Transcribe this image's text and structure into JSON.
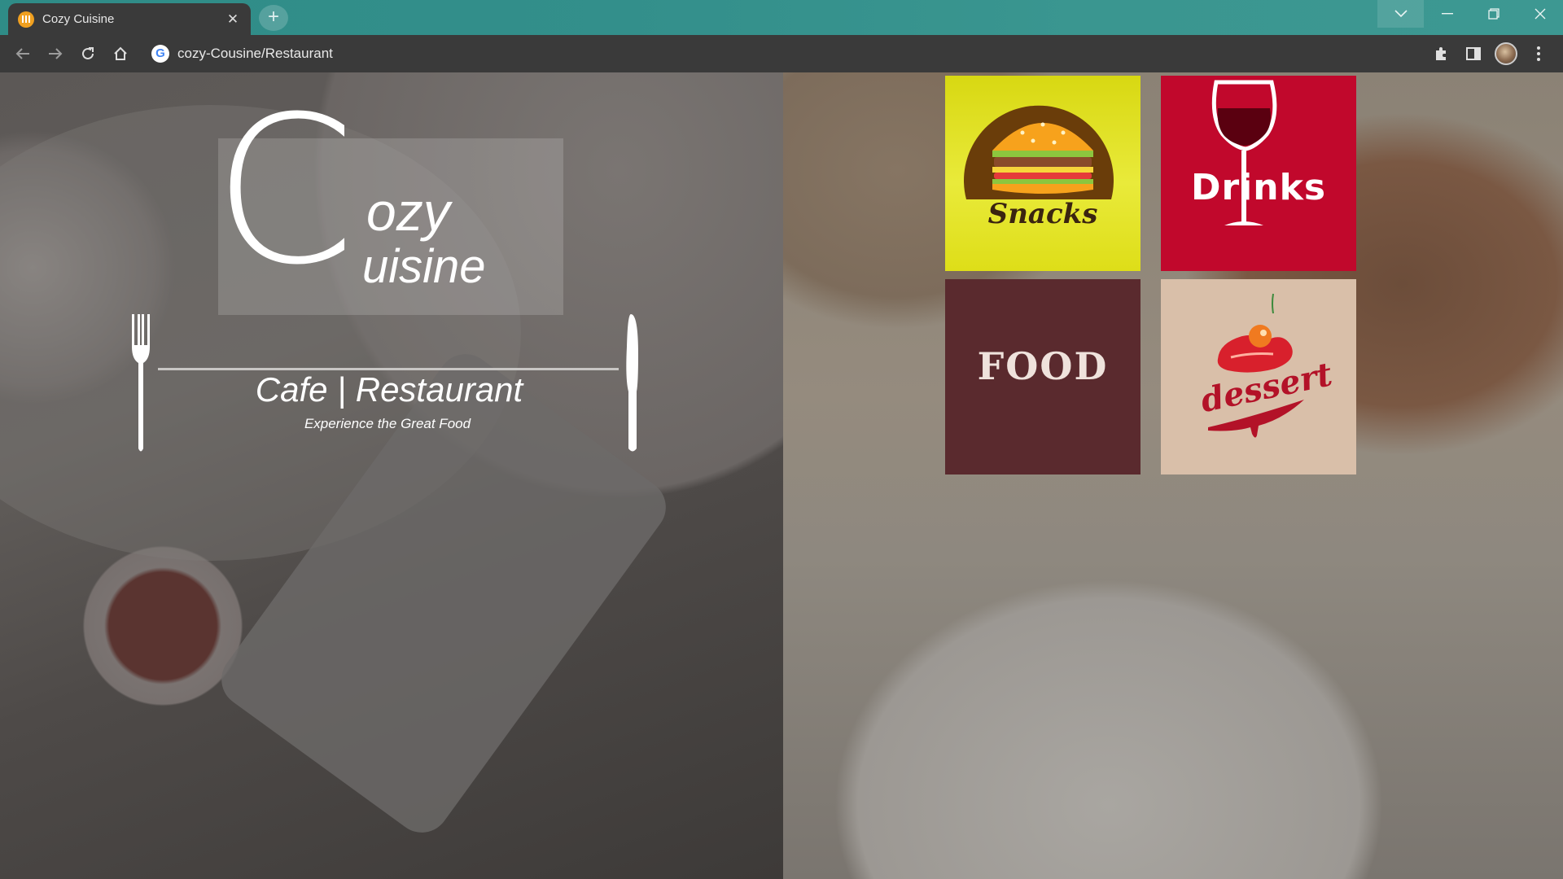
{
  "browser": {
    "tab_title": "Cozy Cuisine",
    "new_tab_label": "+",
    "url": "cozy-Cousine/Restaurant",
    "close_glyph": "✕"
  },
  "logo": {
    "initial_c": "C",
    "line1": "ozy",
    "line2": "uisine"
  },
  "tagline": "Cafe | Restaurant",
  "subtagline": "Experience the Great Food",
  "menu": {
    "snacks_label": "Snacks",
    "drinks_label": "Drinks",
    "food_label": "FOOD",
    "dessert_label": "dessert"
  },
  "colors": {
    "snacks_bg": "#dede18",
    "drinks_bg": "#c1082c",
    "food_bg": "#5a2a2e",
    "dessert_bg": "#d9bfa9",
    "tabstrip": "#338f8b"
  }
}
